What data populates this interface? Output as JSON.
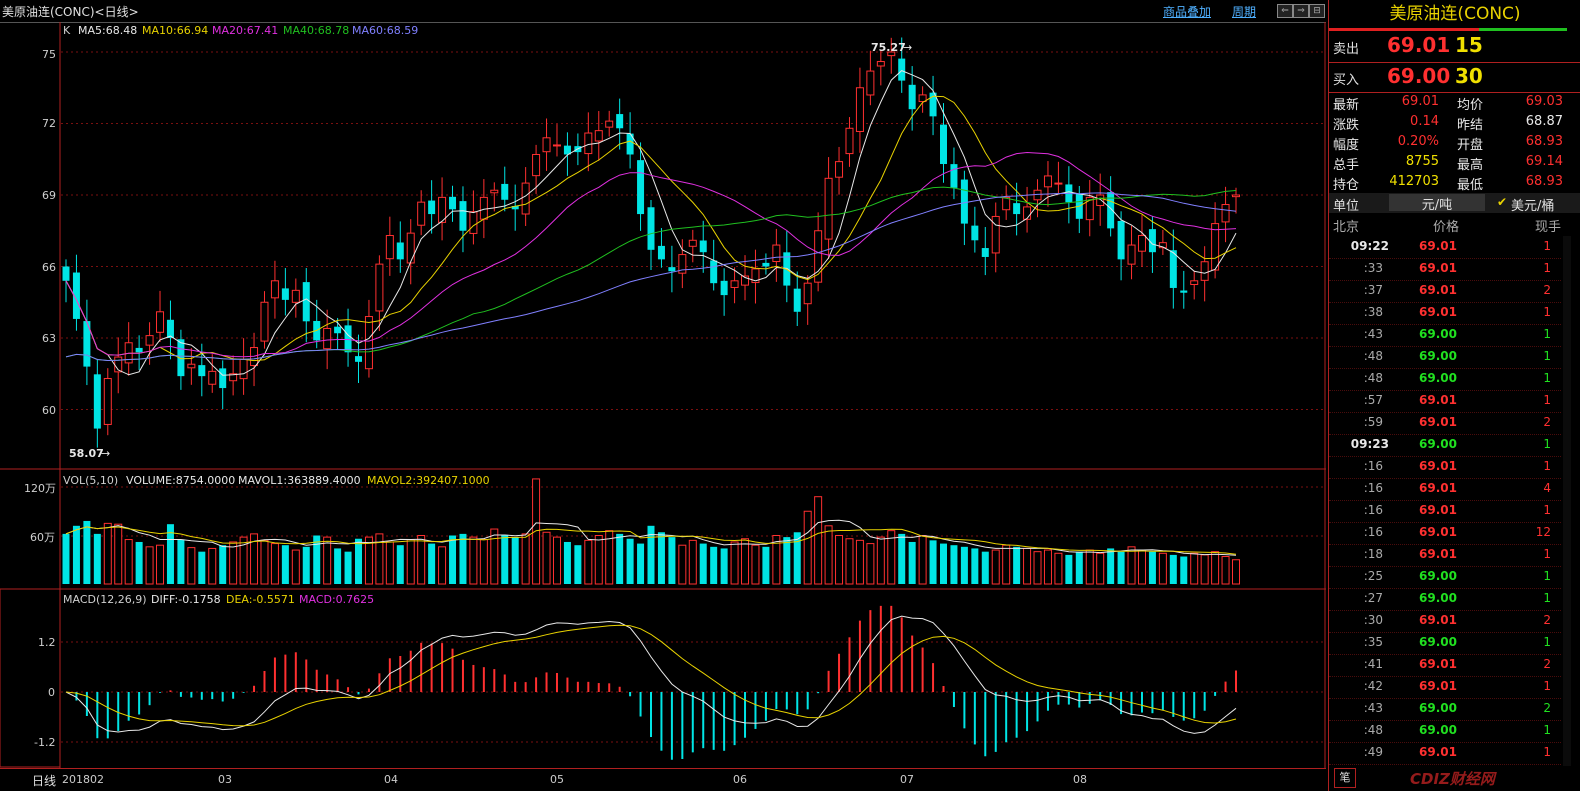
{
  "header": {
    "title": "美原油连(CONC)<日线>",
    "overlay_link": "商品叠加",
    "period_link": "周期"
  },
  "kline": {
    "indicator_label": "K",
    "ma5": "MA5:68.48",
    "ma10": "MA10:66.94",
    "ma20": "MA20:67.41",
    "ma40": "MA40:68.78",
    "ma60": "MA60:68.59",
    "y_ticks": [
      "75",
      "72",
      "69",
      "66",
      "63",
      "60"
    ],
    "high_label": "75.27",
    "low_label": "58.07"
  },
  "volume": {
    "label": "VOL(5,10)",
    "volume": "VOLUME:8754.0000",
    "mavol1": "MAVOL1:363889.4000",
    "mavol2": "MAVOL2:392407.1000",
    "y_ticks": [
      "120万",
      "60万"
    ]
  },
  "macd": {
    "label": "MACD(12,26,9)",
    "diff": "DIFF:-0.1758",
    "dea": "DEA:-0.5571",
    "macd": "MACD:0.7625",
    "y_ticks": [
      "1.2",
      "0",
      "-1.2"
    ]
  },
  "xaxis": {
    "period": "日线",
    "labels": [
      "201802",
      "03",
      "04",
      "05",
      "06",
      "07",
      "08"
    ]
  },
  "quote": {
    "name": "美原油连(CONC)",
    "sell_label": "卖出",
    "sell_price": "69.01",
    "sell_qty": "15",
    "buy_label": "买入",
    "buy_price": "69.00",
    "buy_qty": "30",
    "stats": [
      {
        "l1": "最新",
        "v1": "69.01",
        "c1": "red",
        "l2": "均价",
        "v2": "69.03",
        "c2": "red"
      },
      {
        "l1": "涨跌",
        "v1": "0.14",
        "c1": "red",
        "l2": "昨结",
        "v2": "68.87",
        "c2": "white"
      },
      {
        "l1": "幅度",
        "v1": "0.20%",
        "c1": "red",
        "l2": "开盘",
        "v2": "68.93",
        "c2": "red"
      },
      {
        "l1": "总手",
        "v1": "8755",
        "c1": "yellow",
        "l2": "最高",
        "v2": "69.14",
        "c2": "red"
      },
      {
        "l1": "持仓",
        "v1": "412703",
        "c1": "yellow",
        "l2": "最低",
        "v2": "68.93",
        "c2": "red"
      }
    ],
    "unit_label": "单位",
    "unit_value": "元/吨",
    "unit_alt": "美元/桶",
    "ticks_header": {
      "time": "北京",
      "price": "价格",
      "qty": "现手"
    },
    "ticks": [
      {
        "t": "09:22",
        "p": "69.01",
        "q": "1",
        "pc": "red",
        "qc": "red"
      },
      {
        "t": ":33",
        "p": "69.01",
        "q": "1",
        "pc": "red",
        "qc": "red"
      },
      {
        "t": ":37",
        "p": "69.01",
        "q": "2",
        "pc": "red",
        "qc": "red"
      },
      {
        "t": ":38",
        "p": "69.01",
        "q": "1",
        "pc": "red",
        "qc": "red"
      },
      {
        "t": ":43",
        "p": "69.00",
        "q": "1",
        "pc": "green",
        "qc": "green"
      },
      {
        "t": ":48",
        "p": "69.00",
        "q": "1",
        "pc": "green",
        "qc": "green"
      },
      {
        "t": ":48",
        "p": "69.00",
        "q": "1",
        "pc": "green",
        "qc": "green"
      },
      {
        "t": ":57",
        "p": "69.01",
        "q": "1",
        "pc": "red",
        "qc": "red"
      },
      {
        "t": ":59",
        "p": "69.01",
        "q": "2",
        "pc": "red",
        "qc": "red"
      },
      {
        "t": "09:23",
        "p": "69.00",
        "q": "1",
        "pc": "green",
        "qc": "green"
      },
      {
        "t": ":16",
        "p": "69.01",
        "q": "1",
        "pc": "red",
        "qc": "red"
      },
      {
        "t": ":16",
        "p": "69.01",
        "q": "4",
        "pc": "red",
        "qc": "red"
      },
      {
        "t": ":16",
        "p": "69.01",
        "q": "1",
        "pc": "red",
        "qc": "red"
      },
      {
        "t": ":16",
        "p": "69.01",
        "q": "12",
        "pc": "red",
        "qc": "red"
      },
      {
        "t": ":18",
        "p": "69.01",
        "q": "1",
        "pc": "red",
        "qc": "red"
      },
      {
        "t": ":25",
        "p": "69.00",
        "q": "1",
        "pc": "green",
        "qc": "green"
      },
      {
        "t": ":27",
        "p": "69.00",
        "q": "1",
        "pc": "green",
        "qc": "green"
      },
      {
        "t": ":30",
        "p": "69.01",
        "q": "2",
        "pc": "red",
        "qc": "red"
      },
      {
        "t": ":35",
        "p": "69.00",
        "q": "1",
        "pc": "green",
        "qc": "green"
      },
      {
        "t": ":41",
        "p": "69.01",
        "q": "2",
        "pc": "red",
        "qc": "red"
      },
      {
        "t": ":42",
        "p": "69.01",
        "q": "1",
        "pc": "red",
        "qc": "red"
      },
      {
        "t": ":43",
        "p": "69.00",
        "q": "2",
        "pc": "green",
        "qc": "green"
      },
      {
        "t": ":48",
        "p": "69.00",
        "q": "1",
        "pc": "green",
        "qc": "green"
      },
      {
        "t": ":49",
        "p": "69.01",
        "q": "1",
        "pc": "red",
        "qc": "red"
      }
    ],
    "footer_tab": "笔",
    "watermark": "CDIZ财经网"
  },
  "colors": {
    "up": "#ff3030",
    "down": "#00e5e5",
    "ma5": "#e8e8e8",
    "ma10": "#e8d200",
    "ma20": "#e030e0",
    "ma40": "#20c020",
    "ma60": "#8080ff",
    "grid": "#7a1010"
  },
  "chart_data": [
    {
      "type": "candlestick",
      "title": "美原油连(CONC)<日线>",
      "ylim": [
        58,
        76
      ],
      "x": [
        "201802",
        "03",
        "04",
        "05",
        "06",
        "07",
        "08"
      ],
      "close": [
        65.4,
        63.8,
        61.8,
        59.2,
        61.3,
        62.2,
        62.8,
        62.4,
        63.1,
        64.1,
        63.0,
        61.4,
        61.9,
        61.4,
        61.6,
        60.9,
        61.5,
        62.1,
        62.6,
        64.5,
        65.4,
        64.6,
        65.0,
        63.7,
        62.9,
        63.4,
        63.2,
        62.4,
        62.0,
        63.9,
        66.1,
        67.3,
        66.3,
        67.4,
        68.7,
        68.2,
        68.9,
        68.4,
        67.5,
        68.3,
        68.9,
        69.2,
        68.8,
        68.4,
        69.5,
        70.7,
        71.4,
        71.1,
        70.7,
        70.8,
        71.6,
        71.7,
        72.1,
        71.8,
        70.7,
        68.2,
        66.7,
        66.3,
        65.8,
        66.5,
        67.1,
        66.6,
        65.3,
        64.8,
        65.4,
        65.6,
        65.9,
        66.0,
        66.9,
        65.2,
        64.1,
        65.3,
        67.5,
        69.7,
        70.4,
        71.8,
        73.5,
        74.2,
        74.6,
        75.0,
        73.8,
        72.6,
        73.2,
        72.3,
        70.3,
        69.3,
        67.8,
        67.1,
        66.4,
        68.1,
        68.9,
        68.2,
        68.5,
        69.2,
        69.8,
        69.5,
        68.7,
        68.0,
        68.9,
        69.0,
        67.6,
        66.3,
        66.9,
        67.3,
        66.6,
        67.0,
        65.1,
        64.9,
        65.4,
        66.2,
        67.8,
        68.6,
        69.0
      ],
      "series": [
        {
          "name": "MA5",
          "values": [
            68.48
          ]
        },
        {
          "name": "MA10",
          "values": [
            66.94
          ]
        },
        {
          "name": "MA20",
          "values": [
            67.41
          ]
        },
        {
          "name": "MA40",
          "values": [
            68.78
          ]
        },
        {
          "name": "MA60",
          "values": [
            68.59
          ]
        }
      ],
      "annotations": [
        {
          "label": "75.27",
          "value": 75.27
        },
        {
          "label": "58.07",
          "value": 58.07
        }
      ]
    },
    {
      "type": "bar",
      "title": "VOL(5,10)",
      "ylim": [
        0,
        1400000
      ],
      "values_wan": [
        62,
        72,
        78,
        62,
        75,
        74,
        55,
        52,
        46,
        48,
        74,
        55,
        45,
        40,
        44,
        48,
        52,
        58,
        62,
        54,
        50,
        48,
        42,
        46,
        60,
        58,
        44,
        40,
        56,
        58,
        62,
        52,
        48,
        55,
        60,
        50,
        46,
        60,
        62,
        58,
        55,
        68,
        60,
        58,
        62,
        130,
        64,
        58,
        52,
        48,
        54,
        60,
        66,
        62,
        56,
        50,
        72,
        64,
        58,
        48,
        54,
        50,
        46,
        44,
        52,
        56,
        48,
        46,
        60,
        58,
        64,
        90,
        108,
        72,
        60,
        56,
        54,
        50,
        58,
        66,
        62,
        52,
        60,
        54,
        50,
        48,
        46,
        44,
        40,
        42,
        48,
        46,
        44,
        40,
        42,
        38,
        36,
        40,
        42,
        38,
        44,
        40,
        46,
        42,
        40,
        38,
        36,
        34,
        38,
        36,
        40,
        34,
        30
      ],
      "series": [
        {
          "name": "VOLUME",
          "values": [
            8754
          ]
        },
        {
          "name": "MAVOL1",
          "values": [
            363889.4
          ]
        },
        {
          "name": "MAVOL2",
          "values": [
            392407.1
          ]
        }
      ]
    },
    {
      "type": "line",
      "title": "MACD(12,26,9)",
      "ylim": [
        -1.9,
        2.0
      ],
      "series": [
        {
          "name": "DIFF",
          "values": [
            -0.1758
          ]
        },
        {
          "name": "DEA",
          "values": [
            -0.5571
          ]
        },
        {
          "name": "MACD",
          "values": [
            0.7625
          ]
        }
      ]
    }
  ]
}
